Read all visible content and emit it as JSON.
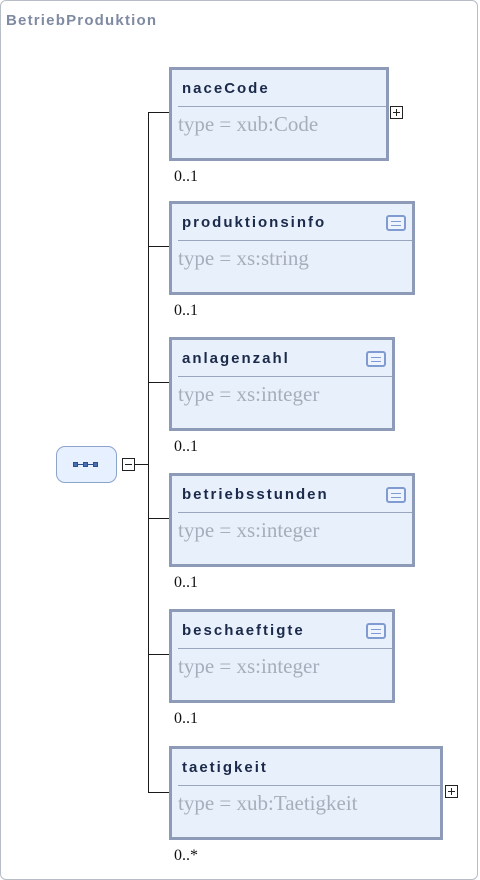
{
  "diagram": {
    "title": "BetriebProduktion",
    "compositor": "sequence",
    "elements": [
      {
        "name": "naceCode",
        "type": "type = xub:Code",
        "cardinality": "0..1",
        "icon": "expand-plus-icon"
      },
      {
        "name": "produktionsinfo",
        "type": "type = xs:string",
        "cardinality": "0..1",
        "icon": "documentation-icon"
      },
      {
        "name": "anlagenzahl",
        "type": "type = xs:integer",
        "cardinality": "0..1",
        "icon": "documentation-icon"
      },
      {
        "name": "betriebsstunden",
        "type": "type = xs:integer",
        "cardinality": "0..1",
        "icon": "documentation-icon"
      },
      {
        "name": "beschaeftigte",
        "type": "type = xs:integer",
        "cardinality": "0..1",
        "icon": "documentation-icon"
      },
      {
        "name": "taetigkeit",
        "type": "type = xub:Taetigkeit",
        "cardinality": "0..*",
        "icon": "expand-plus-icon"
      }
    ]
  }
}
